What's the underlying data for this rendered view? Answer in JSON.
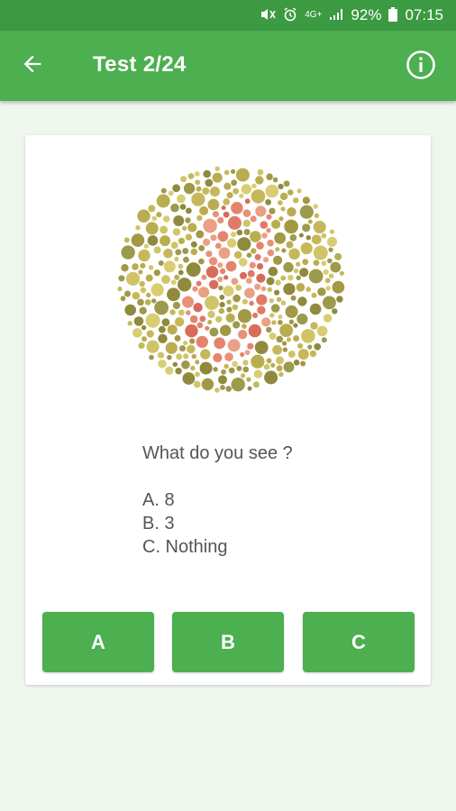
{
  "status_bar": {
    "network": "4G+",
    "battery_percent": "92%",
    "time": "07:15",
    "icons": [
      "mute-icon",
      "alarm-icon",
      "network-4g-icon",
      "signal-icon",
      "battery-icon"
    ]
  },
  "app_bar": {
    "title": "Test 2/24",
    "back_icon": "arrow-left-icon",
    "info_icon": "info-icon"
  },
  "plate": {
    "type": "ishihara-color-plate",
    "hidden_digit": "8"
  },
  "question": {
    "text": "What do you see ?",
    "options": [
      "A. 8",
      "B. 3",
      "C. Nothing"
    ]
  },
  "answers": {
    "a": "A",
    "b": "B",
    "c": "C"
  },
  "colors": {
    "status_bar": "#3b9a42",
    "app_bar": "#4caf50",
    "button": "#4caf50",
    "background": "#eef6ee",
    "plate_dots_background": "#b9ad50",
    "plate_dots_figure": "#e07a66"
  }
}
